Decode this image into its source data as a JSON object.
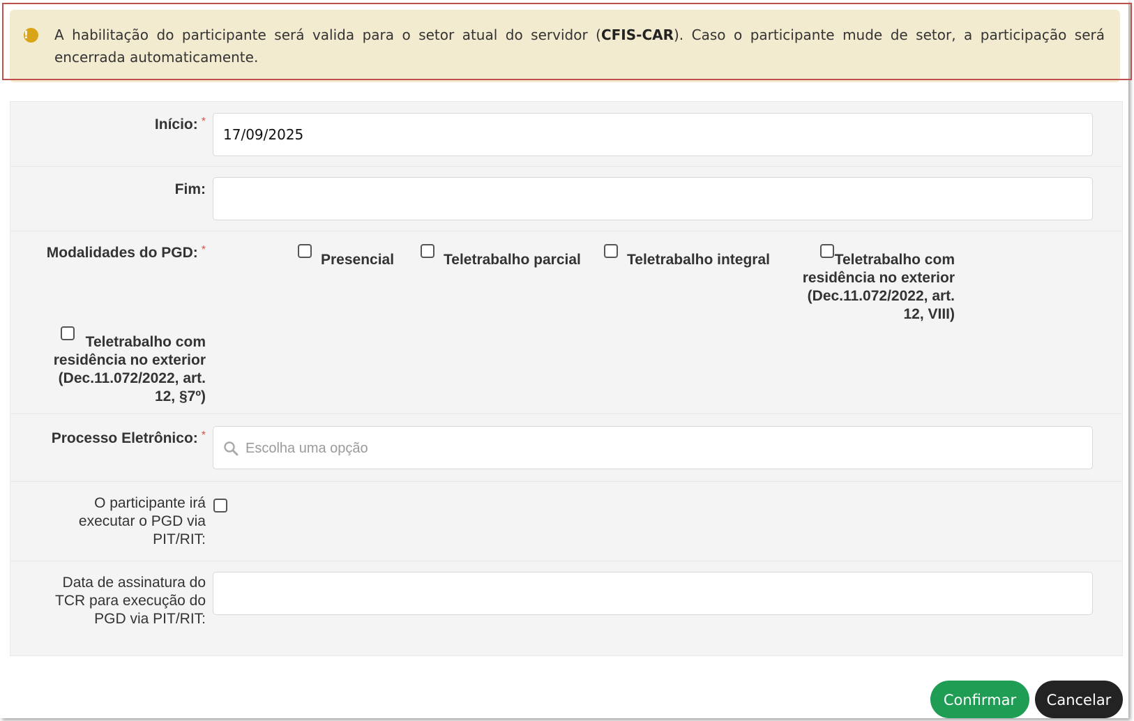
{
  "alert": {
    "icon": "exclamation-circle-icon",
    "text_before": "A habilitação do participante será valida para o setor atual do servidor (",
    "sector": "CFIS-CAR",
    "text_after": "). Caso o participante mude de setor, a participação será encerrada automaticamente.",
    "color": "#f3ebcf"
  },
  "form": {
    "inicio": {
      "label": "Início:",
      "required": "*",
      "value": "17/09/2025"
    },
    "fim": {
      "label": "Fim:",
      "value": ""
    },
    "modalidades": {
      "label": "Modalidades do PGD:",
      "required": "*",
      "options": [
        {
          "label": "Presencial",
          "checked": false
        },
        {
          "label": "Teletrabalho parcial",
          "checked": false
        },
        {
          "label": "Teletrabalho integral",
          "checked": false
        },
        {
          "label_lines": [
            "Teletrabalho com",
            "residência no exterior",
            "(Dec.11.072/2022, art.",
            "12, VIII)"
          ],
          "checked": false
        },
        {
          "label_lines": [
            "Teletrabalho com",
            "residência no exterior",
            "(Dec.11.072/2022, art.",
            "12, §7º)"
          ],
          "checked": false
        }
      ]
    },
    "processo": {
      "label": "Processo Eletrônico:",
      "required": "*",
      "placeholder": "Escolha uma opção",
      "icon": "search-icon"
    },
    "pit_rit": {
      "label_lines": [
        "O participante irá",
        "executar o PGD via",
        "PIT/RIT:"
      ],
      "checked": false
    },
    "data_tcr": {
      "label_lines": [
        "Data de assinatura do",
        "TCR para execução do",
        "PGD via PIT/RIT:"
      ],
      "value": ""
    }
  },
  "buttons": {
    "confirm": "Confirmar",
    "cancel": "Cancelar",
    "confirm_color": "#1f9d55",
    "cancel_color": "#232323"
  }
}
